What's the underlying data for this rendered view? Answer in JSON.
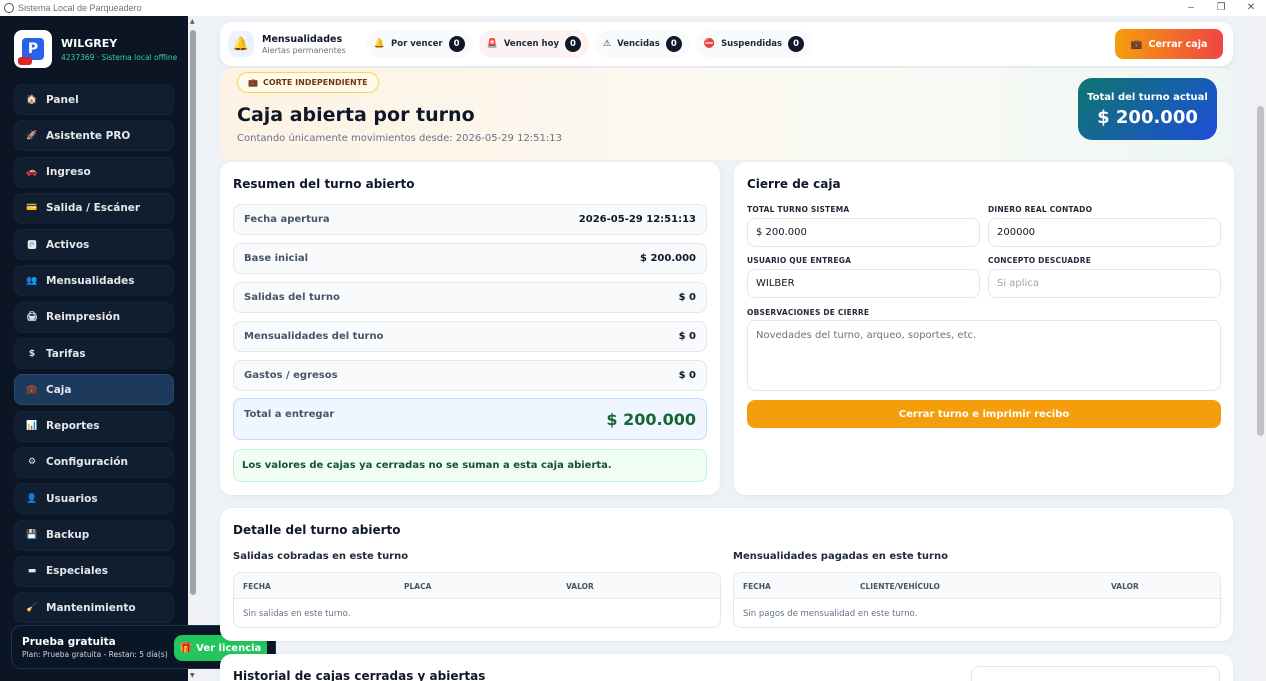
{
  "window": {
    "title": "Sistema Local de Parqueadero"
  },
  "brand": {
    "name": "WILGREY",
    "subtitle": "4237369 · Sistema local offline"
  },
  "nav": [
    {
      "label": "Panel",
      "icon": "🏠"
    },
    {
      "label": "Asistente PRO",
      "icon": "🚀"
    },
    {
      "label": "Ingreso",
      "icon": "🚗"
    },
    {
      "label": "Salida / Escáner",
      "icon": "💳"
    },
    {
      "label": "Activos",
      "icon": "🅿"
    },
    {
      "label": "Mensualidades",
      "icon": "👥"
    },
    {
      "label": "Reimpresión",
      "icon": "🖨"
    },
    {
      "label": "Tarifas",
      "icon": "$"
    },
    {
      "label": "Caja",
      "icon": "💼"
    },
    {
      "label": "Reportes",
      "icon": "📊"
    },
    {
      "label": "Configuración",
      "icon": "⚙"
    },
    {
      "label": "Usuarios",
      "icon": "👤"
    },
    {
      "label": "Backup",
      "icon": "💾"
    },
    {
      "label": "Especiales",
      "icon": "▬"
    },
    {
      "label": "Mantenimiento",
      "icon": "🧹"
    }
  ],
  "nav_active": "Caja",
  "trial": {
    "title": "Prueba gratuita",
    "detail": "Plan: Prueba gratuita - Restan: 5 día(s)",
    "button": "Ver licencia"
  },
  "alerts": {
    "title": "Mensualidades",
    "subtitle": "Alertas permanentes",
    "items": [
      {
        "label": "Por vencer",
        "count": "0"
      },
      {
        "label": "Vencen hoy",
        "count": "0"
      },
      {
        "label": "Vencidas",
        "count": "0"
      },
      {
        "label": "Suspendidas",
        "count": "0"
      }
    ],
    "close_button": "Cerrar caja"
  },
  "hero": {
    "badge": "CORTE INDEPENDIENTE",
    "title": "Caja abierta por turno",
    "subtitle": "Contando únicamente movimientos desde: 2026-05-29 12:51:13",
    "total_label": "Total del turno actual",
    "total_value": "$ 200.000"
  },
  "summary": {
    "title": "Resumen del turno abierto",
    "rows": [
      {
        "label": "Fecha apertura",
        "value": "2026-05-29 12:51:13"
      },
      {
        "label": "Base inicial",
        "value": "$ 200.000"
      },
      {
        "label": "Salidas del turno",
        "value": "$ 0"
      },
      {
        "label": "Mensualidades del turno",
        "value": "$ 0"
      },
      {
        "label": "Gastos / egresos",
        "value": "$ 0"
      }
    ],
    "total_label": "Total a entregar",
    "total_value": "$ 200.000",
    "note": "Los valores de cajas ya cerradas no se suman a esta caja abierta."
  },
  "cierre": {
    "title": "Cierre de caja",
    "total_label": "TOTAL TURNO SISTEMA",
    "total_value": "$ 200.000",
    "counted_label": "DINERO REAL CONTADO",
    "counted_value": "200000",
    "user_label": "USUARIO QUE ENTREGA",
    "user_value": "WILBER",
    "concept_label": "CONCEPTO DESCUADRE",
    "concept_placeholder": "Si aplica",
    "obs_label": "OBSERVACIONES DE CIERRE",
    "obs_placeholder": "Novedades del turno, arqueo, soportes, etc.",
    "button": "Cerrar turno e imprimir recibo"
  },
  "detalle": {
    "title": "Detalle del turno abierto",
    "salidas": {
      "title": "Salidas cobradas en este turno",
      "columns": [
        "FECHA",
        "PLACA",
        "VALOR"
      ],
      "empty": "Sin salidas en este turno."
    },
    "mensualidades": {
      "title": "Mensualidades pagadas en este turno",
      "columns": [
        "FECHA",
        "CLIENTE/VEHÍCULO",
        "VALOR"
      ],
      "empty": "Sin pagos de mensualidad en este turno."
    }
  },
  "historial": {
    "title": "Historial de cajas cerradas y abiertas"
  }
}
